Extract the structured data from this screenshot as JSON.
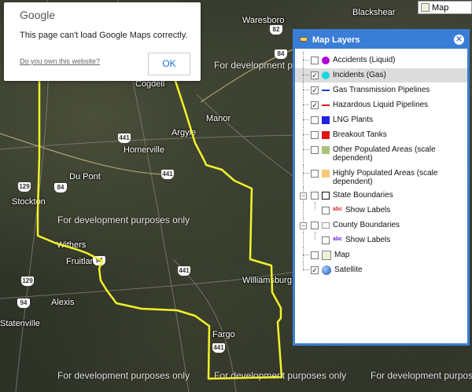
{
  "google_error": {
    "logo": "Google",
    "message": "This page can't load Google Maps correctly.",
    "own_site_link": "Do you own this website?",
    "ok_button": "OK"
  },
  "map_type": {
    "label": "Map"
  },
  "watermark": "For development purposes only",
  "towns": [
    "Blackshear",
    "Waresboro",
    "Cogdell",
    "Manor",
    "Argyle",
    "Homerville",
    "Du Pont",
    "Stockton",
    "Withers",
    "Fruitland",
    "Williamsburg",
    "Alexis",
    "Statenville",
    "Fargo"
  ],
  "route_shields": [
    "82",
    "84",
    "441",
    "84",
    "441",
    "129",
    "94",
    "94",
    "129",
    "441",
    "441"
  ],
  "layers_panel": {
    "title": "Map Layers",
    "close_icon": "close-icon",
    "items": [
      {
        "label": "Accidents (Liquid)",
        "checked": false,
        "swatch": "#b000d8"
      },
      {
        "label": "Incidents (Gas)",
        "checked": true,
        "swatch": "#19d8e0"
      },
      {
        "label": "Gas Transmission Pipelines",
        "checked": true,
        "swatch": "#1f3bd0"
      },
      {
        "label": "Hazardous Liquid Pipelines",
        "checked": true,
        "swatch": "#e0141a"
      },
      {
        "label": "LNG Plants",
        "checked": false,
        "swatch": "#2020e0"
      },
      {
        "label": "Breakout Tanks",
        "checked": false,
        "swatch": "#e01414"
      },
      {
        "label": "Other Populated Areas (scale dependent)",
        "checked": false,
        "swatch": "#a9c27a"
      },
      {
        "label": "Highly Populated Areas (scale dependent)",
        "checked": false,
        "swatch": "#f5c97a"
      },
      {
        "label": "State Boundaries",
        "checked": false
      },
      {
        "label": "Show Labels",
        "checked": false
      },
      {
        "label": "County Boundaries",
        "checked": false
      },
      {
        "label": "Show Labels",
        "checked": false
      },
      {
        "label": "Map",
        "checked": false
      },
      {
        "label": "Satellite",
        "checked": true
      }
    ]
  }
}
